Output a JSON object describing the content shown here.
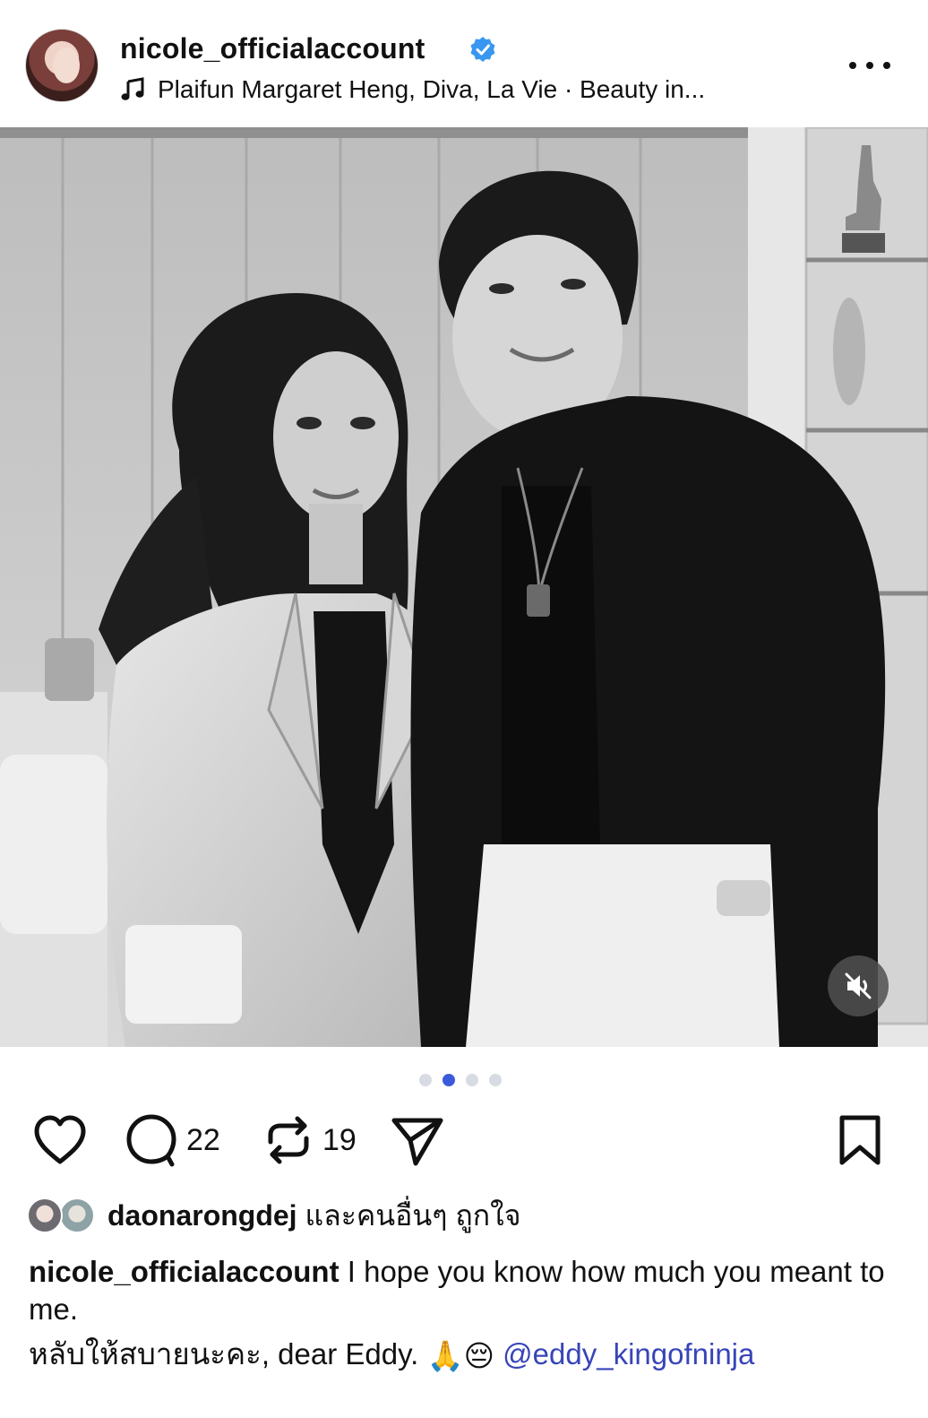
{
  "post": {
    "username": "nicole_officialaccount",
    "verified": true,
    "music": "Plaifun Margaret Heng, Diva, La Vie · Beauty in..."
  },
  "carousel": {
    "total": 4,
    "active_index": 1
  },
  "actions": {
    "comments_count": "22",
    "reposts_count": "19"
  },
  "likes": {
    "user": "daonarongdej",
    "and_others_text": "และคนอื่นๆ",
    "liked_text": "ถูกใจ"
  },
  "caption": {
    "username": "nicole_officialaccount",
    "line1": "I hope you know how much you meant to me.",
    "line2_text": "หลับให้สบายนะคะ, dear Eddy.",
    "emojis": "🙏😔",
    "mention": "@eddy_kingofninja"
  },
  "colors": {
    "verified_blue": "#3897f0",
    "active_dot": "#3b5bdb",
    "inactive_dot": "#d7dbe3",
    "mention": "#3845b8"
  },
  "icons": [
    "verified-badge-icon",
    "music-note-icon",
    "more-options-icon",
    "mute-icon",
    "heart-icon",
    "comment-icon",
    "repost-icon",
    "share-icon",
    "bookmark-icon"
  ]
}
